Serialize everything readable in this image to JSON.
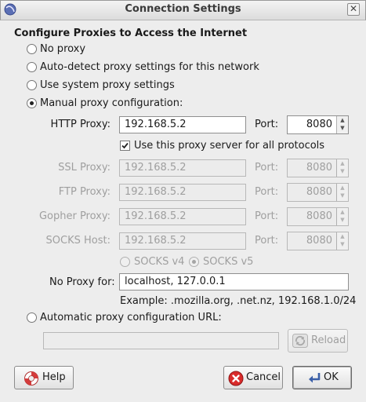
{
  "window": {
    "title": "Connection Settings"
  },
  "section_title": "Configure Proxies to Access the Internet",
  "options": {
    "no_proxy": "No proxy",
    "auto_detect": "Auto-detect proxy settings for this network",
    "system": "Use system proxy settings",
    "manual": "Manual proxy configuration:",
    "selected": "manual"
  },
  "manual": {
    "http_label": "HTTP Proxy:",
    "http_value": "192.168.5.2",
    "port_label": "Port:",
    "http_port": "8080",
    "use_all_label": "Use this proxy server for all protocols",
    "use_all_checked": true,
    "ssl_label": "SSL Proxy:",
    "ssl_value": "192.168.5.2",
    "ssl_port": "8080",
    "ftp_label": "FTP Proxy:",
    "ftp_value": "192.168.5.2",
    "ftp_port": "8080",
    "gopher_label": "Gopher Proxy:",
    "gopher_value": "192.168.5.2",
    "gopher_port": "8080",
    "socks_label": "SOCKS Host:",
    "socks_value": "192.168.5.2",
    "socks_port": "8080",
    "socks_v4": "SOCKS v4",
    "socks_v5": "SOCKS v5",
    "socks_selected": "v5",
    "no_proxy_label": "No Proxy for:",
    "no_proxy_value": "localhost, 127.0.0.1",
    "example": "Example: .mozilla.org, .net.nz, 192.168.1.0/24"
  },
  "auto_config": {
    "label": "Automatic proxy configuration URL:",
    "url_value": "",
    "reload_label": "Reload"
  },
  "buttons": {
    "help": "Help",
    "cancel": "Cancel",
    "ok": "OK"
  },
  "icons": {
    "app": "firefox-globe-icon",
    "close": "close-icon",
    "help": "lifebuoy-icon",
    "cancel": "cancel-circle-icon",
    "ok": "enter-arrow-icon",
    "reload": "reload-icon"
  }
}
